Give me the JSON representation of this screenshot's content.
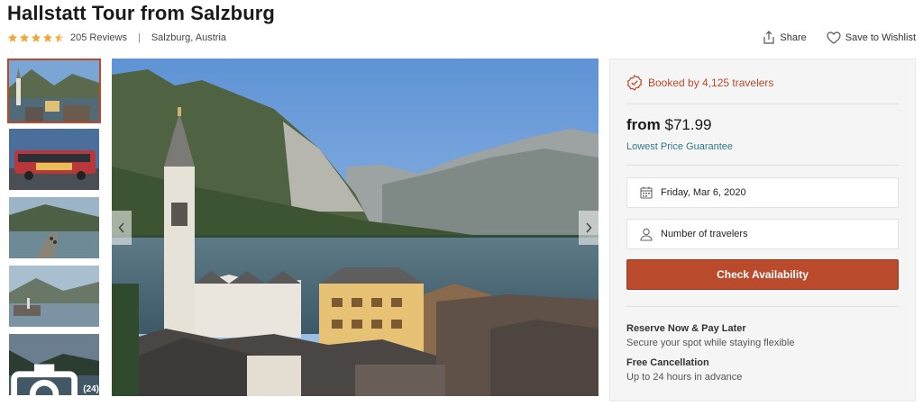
{
  "tour": {
    "title": "Hallstatt Tour from Salzburg",
    "rating_stars": 4.5,
    "reviews": "205 Reviews",
    "separator": "|",
    "location": "Salzburg, Austria"
  },
  "actions": {
    "share": "Share",
    "wishlist": "Save to Wishlist"
  },
  "gallery": {
    "photo_count": "(24)",
    "thumbnails": [
      "hallstatt-village",
      "tour-bus",
      "lakeside-path",
      "lake-shore",
      "lake-mountains"
    ],
    "active_index": 0
  },
  "booking": {
    "booked_text": "Booked by 4,125 travelers",
    "price_prefix": "from",
    "price": "$71.99",
    "guarantee": "Lowest Price Guarantee",
    "date": "Friday, Mar 6, 2020",
    "travelers_placeholder": "Number of travelers",
    "check_button": "Check Availability",
    "reserve_title": "Reserve Now & Pay Later",
    "reserve_text": "Secure your spot while staying flexible",
    "cancel_title": "Free Cancellation",
    "cancel_text": "Up to 24 hours in advance"
  },
  "colors": {
    "accent": "#b94a2c",
    "star": "#f0a736",
    "link": "#2f7a8c",
    "panel_bg": "#f5f5f5"
  }
}
